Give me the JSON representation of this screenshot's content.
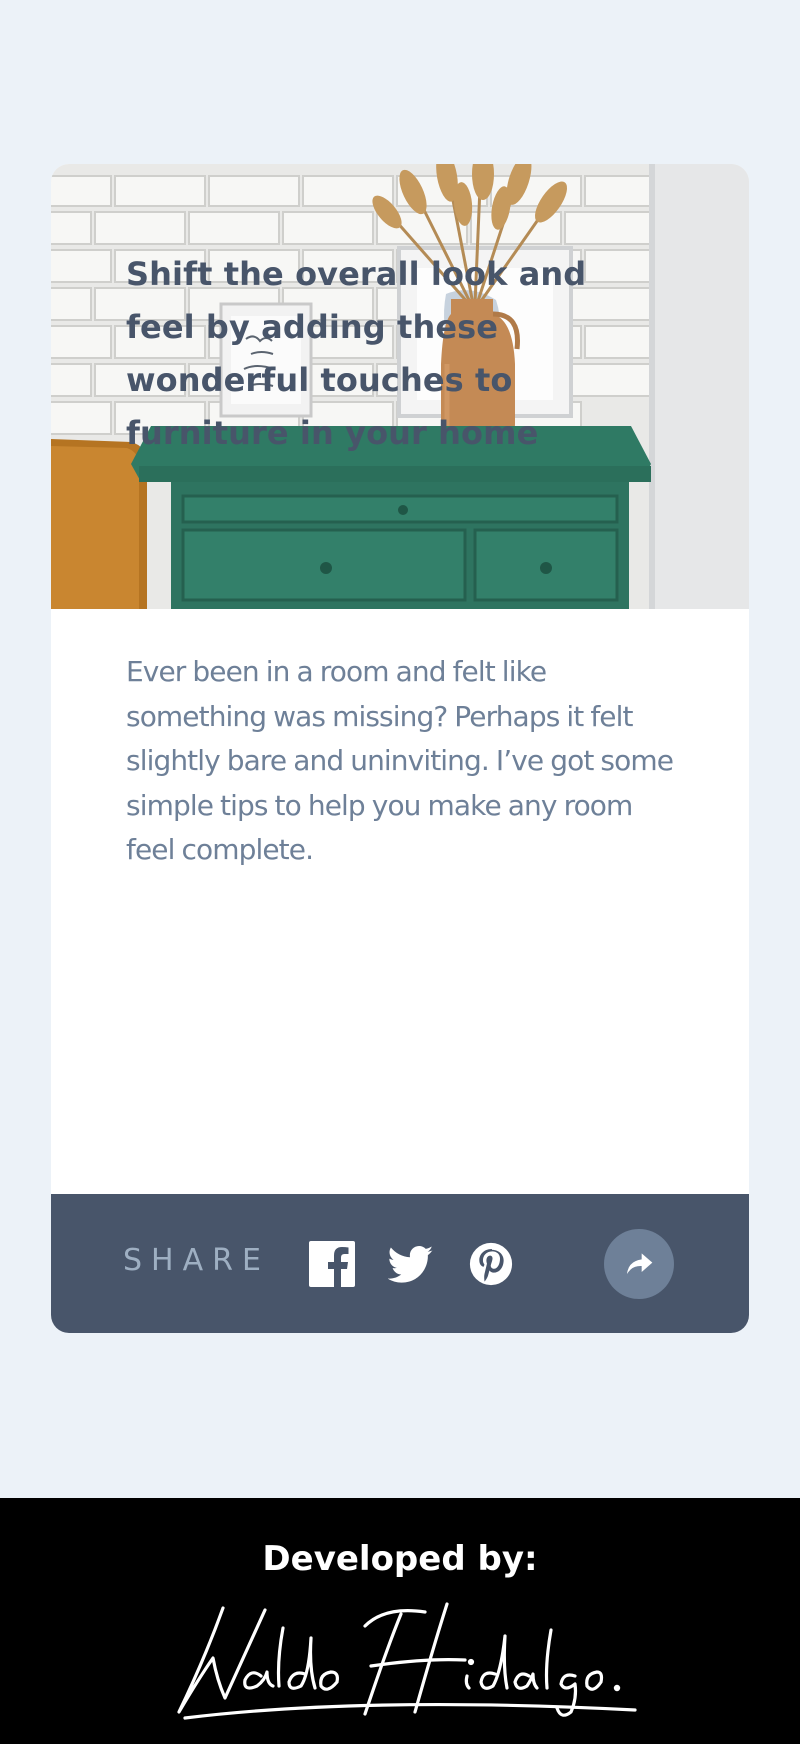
{
  "card": {
    "image_alt": "Green drawer dresser with vase of dried grass and framed art in front of a white brick wall",
    "headline": "Shift the overall look and feel by adding these wonderful touches to furniture in your home",
    "excerpt": "Ever been in a room and felt like something was missing? Perhaps it felt slightly bare and uninviting. I’ve got some simple tips to help you make any room feel complete."
  },
  "share": {
    "label": "SHARE",
    "links": [
      {
        "name": "Facebook",
        "icon": "facebook-icon"
      },
      {
        "name": "Twitter",
        "icon": "twitter-icon"
      },
      {
        "name": "Pinterest",
        "icon": "pinterest-icon"
      }
    ],
    "toggle_icon": "share-arrow-icon"
  },
  "footer": {
    "developed_label": "Developed by:",
    "signature": "Waldo Hidalgo."
  },
  "colors": {
    "page_bg": "#ecf2f8",
    "card_bg": "#ffffff",
    "headline": "#48556a",
    "excerpt": "#6e8098",
    "share_bar": "#48556a",
    "share_label": "#9eafc2",
    "share_button": "#6e8098",
    "footer_bg": "#000000"
  }
}
